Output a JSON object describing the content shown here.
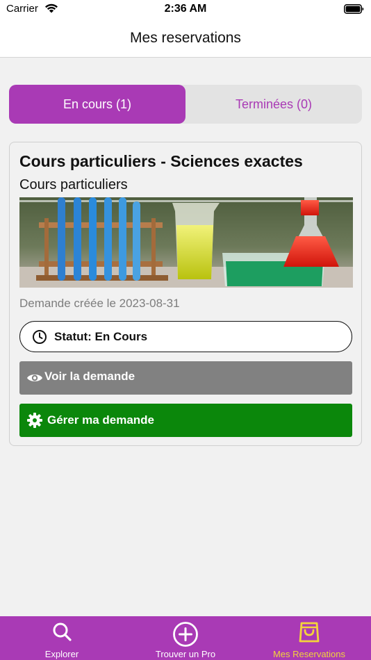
{
  "status_bar": {
    "carrier": "Carrier",
    "time": "2:36 AM"
  },
  "header": {
    "title": "Mes reservations"
  },
  "tabs": [
    {
      "label": "En cours (1)",
      "active": true
    },
    {
      "label": "Terminées (0)",
      "active": false
    }
  ],
  "reservation": {
    "title": "Cours particuliers - Sciences exactes",
    "category": "Cours particuliers",
    "created": "Demande créée le 2023-08-31",
    "status": "Statut: En Cours",
    "view_button": "Voir la demande",
    "manage_button": "Gérer ma demande"
  },
  "bottom_nav": [
    {
      "label": "Explorer",
      "icon": "search-icon",
      "active": false
    },
    {
      "label": "Trouver un Pro",
      "icon": "plus-circle-icon",
      "active": false
    },
    {
      "label": "Mes Reservations",
      "icon": "shopping-bag-icon",
      "active": true
    }
  ],
  "colors": {
    "accent": "#a93ab5",
    "active_nav": "#f3d33b",
    "success": "#0b870b",
    "secondary_button": "#818181"
  }
}
